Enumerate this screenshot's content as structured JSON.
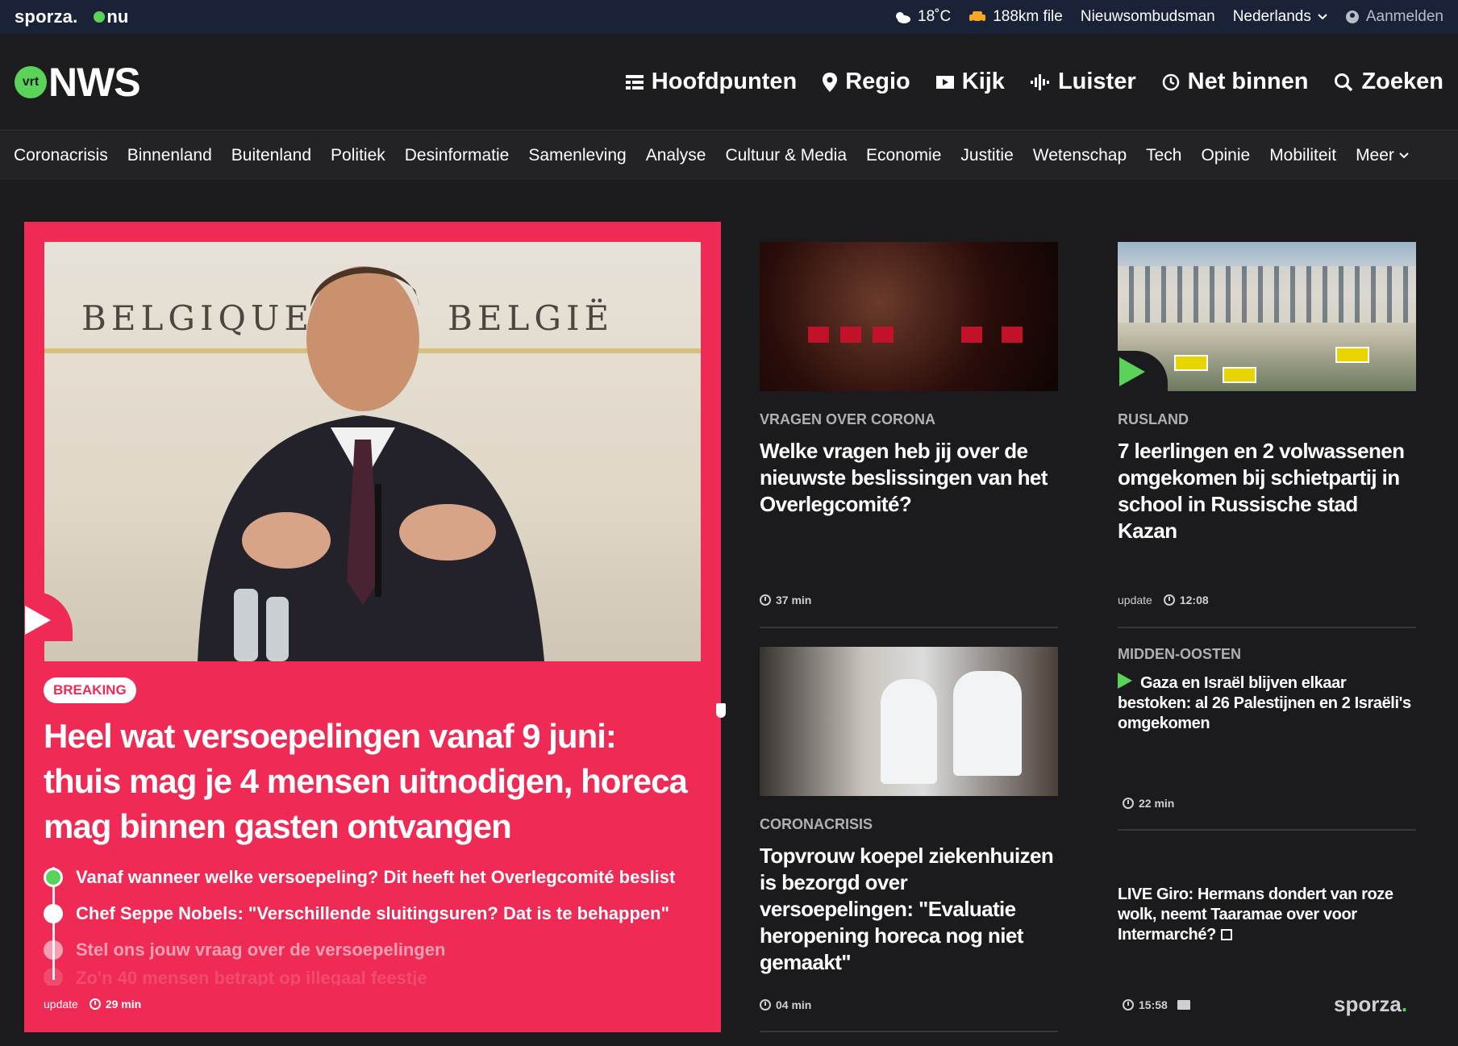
{
  "topbar": {
    "brand_sporza": "sporza.",
    "brand_nu": "nu",
    "weather": "18˚C",
    "traffic": "188km file",
    "ombudsman": "Nieuwsombudsman",
    "language": "Nederlands",
    "login": "Aanmelden"
  },
  "header": {
    "logo_badge": "vrt",
    "logo_text": "NWS",
    "nav": {
      "hoofdpunten": "Hoofdpunten",
      "regio": "Regio",
      "kijk": "Kijk",
      "luister": "Luister",
      "net_binnen": "Net binnen",
      "zoeken": "Zoeken"
    }
  },
  "categories": [
    "Coronacrisis",
    "Binnenland",
    "Buitenland",
    "Politiek",
    "Desinformatie",
    "Samenleving",
    "Analyse",
    "Cultuur & Media",
    "Economie",
    "Justitie",
    "Wetenschap",
    "Tech",
    "Opinie",
    "Mobiliteit"
  ],
  "categories_more": "Meer",
  "hero": {
    "image_wall_left": "BELGIQUE",
    "image_wall_right": "BELGIË",
    "badge": "BREAKING",
    "title": "Heel wat versoepelingen vanaf 9 juni: thuis mag je 4 mensen uitnodigen, horeca mag binnen gasten ontvangen",
    "bullets": [
      "Vanaf wanneer welke versoepeling? Dit heeft het Overlegcomité beslist",
      "Chef Seppe Nobels: \"Verschillende sluitingsuren? Dat is te behappen\"",
      "Stel ons jouw vraag over de versoepelingen",
      "Zo'n 40 mensen betrapt op illegaal feestje"
    ],
    "meta_label": "update",
    "meta_time": "29 min"
  },
  "cards": {
    "c1": {
      "kicker": "VRAGEN OVER CORONA",
      "title": "Welke vragen heb jij over de nieuwste beslissingen van het Overlegcomité?",
      "time": "37 min"
    },
    "c2": {
      "kicker": "RUSLAND",
      "title": "7 leerlingen en 2 volwassenen omgekomen bij schietpartij in school in Russische stad Kazan",
      "meta_label": "update",
      "time": "12:08"
    },
    "c3": {
      "kicker": "CORONACRISIS",
      "title": "Topvrouw koepel ziekenhuizen is bezorgd over versoepelingen: \"Evaluatie heropening horeca nog niet gemaakt\"",
      "time": "04 min"
    },
    "c4": {
      "kicker": "MIDDEN-OOSTEN",
      "title": "Gaza en Israël blijven elkaar bestoken: al 26 Palestijnen en 2 Israëli's omgekomen",
      "time": "22 min"
    },
    "c5": {
      "title": "LIVE Giro: Hermans dondert van roze wolk, neemt Taaramae over voor Intermarché?",
      "time": "15:58",
      "brand": "sporza",
      "brand_dot": "."
    }
  },
  "colors": {
    "accent_red": "#ee2a55",
    "accent_green": "#5bd35b",
    "topbar_bg": "#1a2238",
    "page_bg": "#1b1b1d"
  }
}
